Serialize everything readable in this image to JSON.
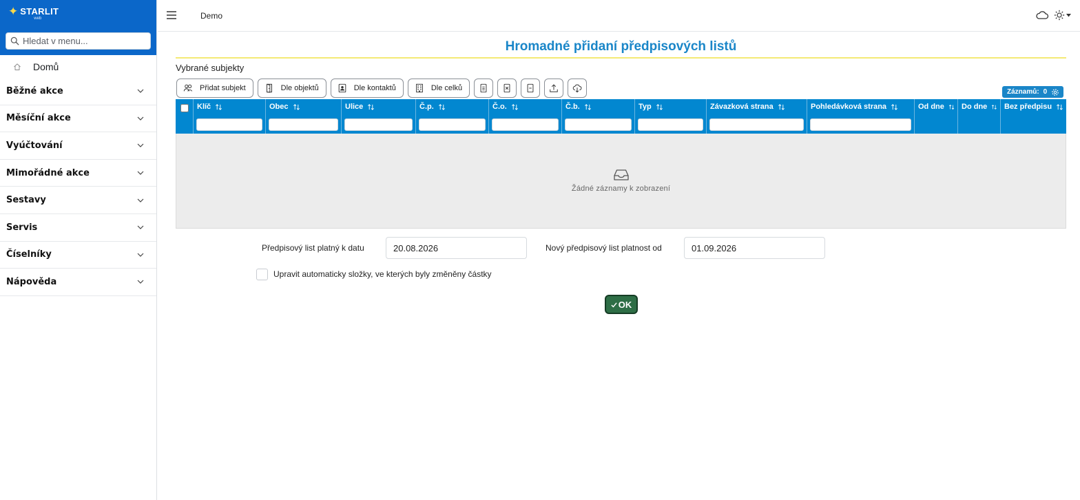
{
  "brand": {
    "name": "STARLIT",
    "sub": "web"
  },
  "sidebar": {
    "search_placeholder": "Hledat v menu...",
    "home_label": "Domů",
    "items": [
      {
        "label": "Běžné akce"
      },
      {
        "label": "Měsíční akce"
      },
      {
        "label": "Vyúčtování"
      },
      {
        "label": "Mimořádné akce"
      },
      {
        "label": "Sestavy"
      },
      {
        "label": "Servis"
      },
      {
        "label": "Číselníky"
      },
      {
        "label": "Nápověda"
      }
    ]
  },
  "topbar": {
    "breadcrumb": "Demo"
  },
  "page": {
    "title": "Hromadné přidaní předpisových listů",
    "section_label": "Vybrané subjekty"
  },
  "toolbar": {
    "add_subject": "Přidat subjekt",
    "by_objects": "Dle objektů",
    "by_contacts": "Dle kontaktů",
    "by_units": "Dle celků"
  },
  "records": {
    "label": "Záznamů:",
    "count": "0"
  },
  "table": {
    "columns": [
      "Klíč",
      "Obec",
      "Ulice",
      "Č.p.",
      "Č.o.",
      "Č.b.",
      "Typ",
      "Závazková strana",
      "Pohledávková strana",
      "Od dne",
      "Do dne",
      "Bez předpisu"
    ],
    "empty_text": "Žádné záznamy k zobrazení"
  },
  "form": {
    "valid_to_label": "Předpisový list platný k datu",
    "valid_to_value": "20.08.2026",
    "new_valid_from_label": "Nový předpisový list platnost od",
    "new_valid_from_value": "01.09.2026",
    "auto_adjust_label": "Upravit automaticky složky, ve kterých byly změněny částky",
    "auto_adjust_checked": false,
    "ok_label": "OK"
  },
  "colors": {
    "brand_blue": "#0b67c9",
    "title_blue": "#1a86c8",
    "table_header": "#0287d0",
    "title_underline": "#f4ea74",
    "ok_green": "#2e6e46"
  }
}
